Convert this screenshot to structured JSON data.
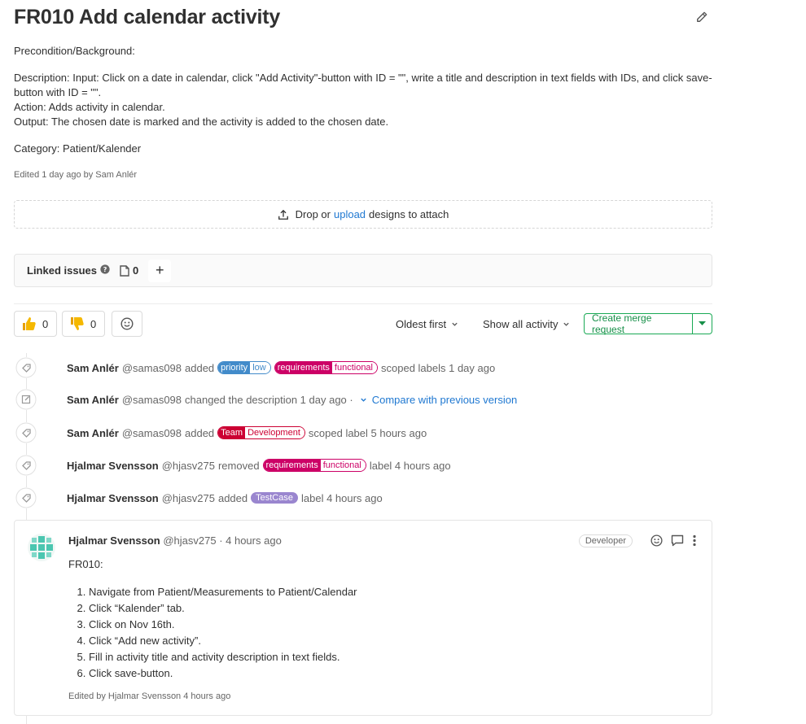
{
  "issue": {
    "title": "FR010 Add calendar activity",
    "precondition": "Precondition/Background:",
    "description_1": "Description: Input: Click on a date in calendar, click \"Add Activity\"-button with ID = \"\", write a title and description in text fields with IDs, and click save-button with ID = \"\".",
    "description_2": "Action: Adds activity in calendar.",
    "description_3": "Output: The chosen date is marked and the activity is added to the chosen date.",
    "category": "Category: Patient/Kalender",
    "edited": "Edited 1 day ago by Sam Anlér"
  },
  "dropzone": {
    "prefix": "Drop or",
    "link": "upload",
    "suffix": "designs to attach"
  },
  "linked_issues": {
    "label": "Linked issues",
    "count": "0",
    "add": "+"
  },
  "awards": {
    "thumbs_up": "0",
    "thumbs_down": "0"
  },
  "controls": {
    "sort": "Oldest first",
    "filter": "Show all activity",
    "merge_request": "Create merge request"
  },
  "events": [
    {
      "author": "Sam Anlér",
      "handle": "@samas098",
      "action": "added",
      "trailing": "scoped labels 1 day ago",
      "labels": [
        {
          "k": "priority",
          "v": "low"
        },
        {
          "k": "requirements",
          "v": "functional"
        }
      ]
    },
    {
      "author": "Sam Anlér",
      "handle": "@samas098",
      "action": "changed the description 1 day ago ·",
      "compare": "Compare with previous version"
    },
    {
      "author": "Sam Anlér",
      "handle": "@samas098",
      "action": "added",
      "trailing": "scoped label 5 hours ago",
      "labels": [
        {
          "k": "Team",
          "v": "Development"
        }
      ]
    },
    {
      "author": "Hjalmar Svensson",
      "handle": "@hjasv275",
      "action": "removed",
      "trailing": "label 4 hours ago",
      "labels": [
        {
          "k": "requirements",
          "v": "functional"
        }
      ]
    },
    {
      "author": "Hjalmar Svensson",
      "handle": "@hjasv275",
      "action": "added",
      "trailing": "label 4 hours ago",
      "plain_label": "TestCase"
    }
  ],
  "comment": {
    "author": "Hjalmar Svensson",
    "meta": "@hjasv275 · 4 hours ago",
    "role": "Developer",
    "intro": "FR010:",
    "steps": [
      "Navigate from Patient/Measurements to Patient/Calendar",
      "Click “Kalender” tab.",
      "Click on Nov 16th.",
      "Click “Add new activity”.",
      "Fill in activity title and activity description in text fields.",
      "Click save-button."
    ],
    "edited": "Edited by Hjalmar Svensson 4 hours ago"
  },
  "colors": {
    "priority": "#428bca",
    "requirements": "#cc0066",
    "team": "#cc0033",
    "testcase": "#9a86cf",
    "link": "#1f78d1",
    "success": "#1aaa55"
  }
}
